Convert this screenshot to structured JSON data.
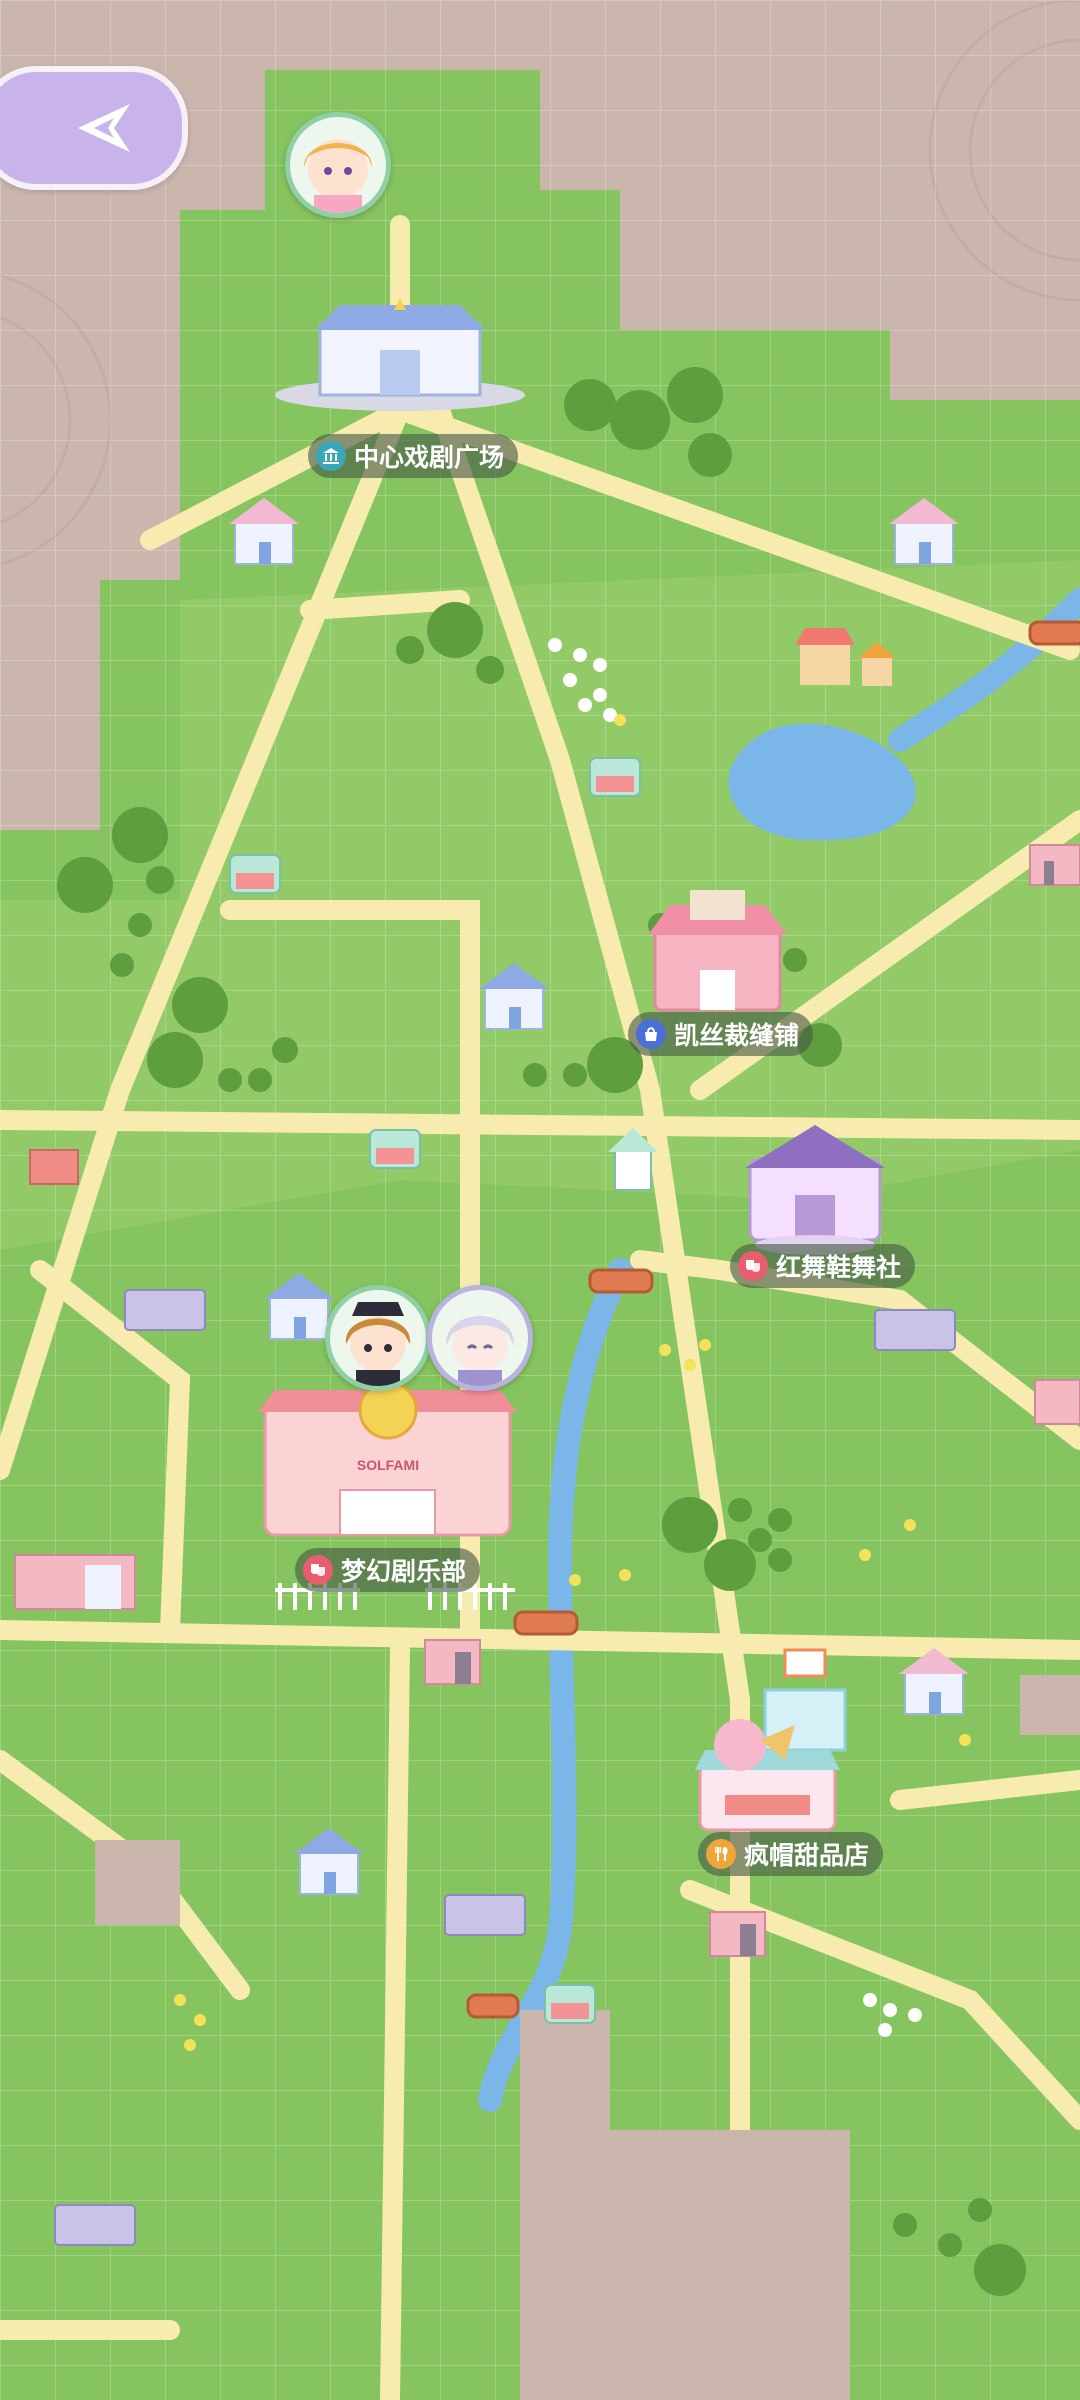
{
  "nav": {
    "back_icon": "compass-arrow-icon"
  },
  "locations": [
    {
      "id": "central-drama-plaza",
      "label": "中心戏剧广场",
      "icon": "museum-icon",
      "icon_color": "#3aa7b8"
    },
    {
      "id": "kaisi-tailor",
      "label": "凯丝裁缝铺",
      "icon": "bag-icon",
      "icon_color": "#4a6fd6"
    },
    {
      "id": "red-dance-shoes",
      "label": "红舞鞋舞社",
      "icon": "drama-mask-icon",
      "icon_color": "#e85d6f"
    },
    {
      "id": "dream-theater",
      "label": "梦幻剧乐部",
      "icon": "drama-mask-icon",
      "icon_color": "#e85d6f"
    },
    {
      "id": "mad-hat-dessert",
      "label": "疯帽甜品店",
      "icon": "fork-spoon-icon",
      "icon_color": "#f0a53a"
    }
  ],
  "avatars": [
    {
      "id": "blonde-girl",
      "hair": "#f2b24c",
      "ring": "#8fd0a7"
    },
    {
      "id": "brown-hair-girl",
      "hair": "#c98a3e",
      "ring": "#8fd0a7"
    },
    {
      "id": "silver-hair-girl",
      "hair": "#d9d4ee",
      "ring": "#b9b3df"
    }
  ],
  "theatre_sign": "SOLFAMI"
}
